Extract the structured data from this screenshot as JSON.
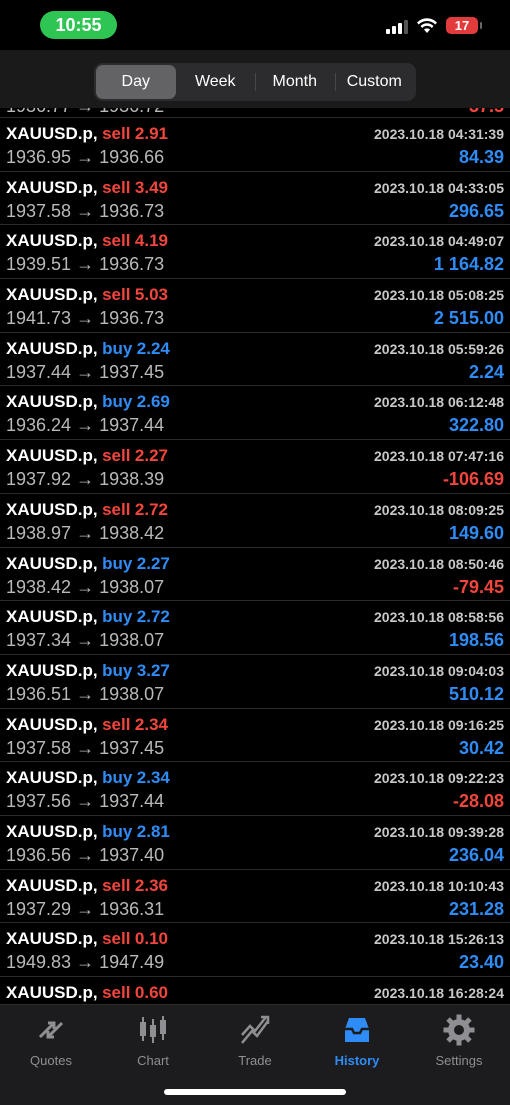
{
  "status_bar": {
    "time": "10:55",
    "battery": "17"
  },
  "segments": [
    {
      "label": "Day",
      "active": true
    },
    {
      "label": "Week",
      "active": false
    },
    {
      "label": "Month",
      "active": false
    },
    {
      "label": "Custom",
      "active": false
    }
  ],
  "arrow": "→",
  "trades": [
    {
      "symbol": "XAUUSD.p,",
      "side": "sell",
      "volume": "2.91",
      "datetime": "2023.10.18 04:31:39",
      "open": "1936.95",
      "close": "1936.66",
      "profit": "84.39"
    },
    {
      "symbol": "XAUUSD.p,",
      "side": "sell",
      "volume": "3.49",
      "datetime": "2023.10.18 04:33:05",
      "open": "1937.58",
      "close": "1936.73",
      "profit": "296.65"
    },
    {
      "symbol": "XAUUSD.p,",
      "side": "sell",
      "volume": "4.19",
      "datetime": "2023.10.18 04:49:07",
      "open": "1939.51",
      "close": "1936.73",
      "profit": "1 164.82"
    },
    {
      "symbol": "XAUUSD.p,",
      "side": "sell",
      "volume": "5.03",
      "datetime": "2023.10.18 05:08:25",
      "open": "1941.73",
      "close": "1936.73",
      "profit": "2 515.00"
    },
    {
      "symbol": "XAUUSD.p,",
      "side": "buy",
      "volume": "2.24",
      "datetime": "2023.10.18 05:59:26",
      "open": "1937.44",
      "close": "1937.45",
      "profit": "2.24"
    },
    {
      "symbol": "XAUUSD.p,",
      "side": "buy",
      "volume": "2.69",
      "datetime": "2023.10.18 06:12:48",
      "open": "1936.24",
      "close": "1937.44",
      "profit": "322.80"
    },
    {
      "symbol": "XAUUSD.p,",
      "side": "sell",
      "volume": "2.27",
      "datetime": "2023.10.18 07:47:16",
      "open": "1937.92",
      "close": "1938.39",
      "profit": "-106.69"
    },
    {
      "symbol": "XAUUSD.p,",
      "side": "sell",
      "volume": "2.72",
      "datetime": "2023.10.18 08:09:25",
      "open": "1938.97",
      "close": "1938.42",
      "profit": "149.60"
    },
    {
      "symbol": "XAUUSD.p,",
      "side": "buy",
      "volume": "2.27",
      "datetime": "2023.10.18 08:50:46",
      "open": "1938.42",
      "close": "1938.07",
      "profit": "-79.45"
    },
    {
      "symbol": "XAUUSD.p,",
      "side": "buy",
      "volume": "2.72",
      "datetime": "2023.10.18 08:58:56",
      "open": "1937.34",
      "close": "1938.07",
      "profit": "198.56"
    },
    {
      "symbol": "XAUUSD.p,",
      "side": "buy",
      "volume": "3.27",
      "datetime": "2023.10.18 09:04:03",
      "open": "1936.51",
      "close": "1938.07",
      "profit": "510.12"
    },
    {
      "symbol": "XAUUSD.p,",
      "side": "sell",
      "volume": "2.34",
      "datetime": "2023.10.18 09:16:25",
      "open": "1937.58",
      "close": "1937.45",
      "profit": "30.42"
    },
    {
      "symbol": "XAUUSD.p,",
      "side": "buy",
      "volume": "2.34",
      "datetime": "2023.10.18 09:22:23",
      "open": "1937.56",
      "close": "1937.44",
      "profit": "-28.08"
    },
    {
      "symbol": "XAUUSD.p,",
      "side": "buy",
      "volume": "2.81",
      "datetime": "2023.10.18 09:39:28",
      "open": "1936.56",
      "close": "1937.40",
      "profit": "236.04"
    },
    {
      "symbol": "XAUUSD.p,",
      "side": "sell",
      "volume": "2.36",
      "datetime": "2023.10.18 10:10:43",
      "open": "1937.29",
      "close": "1936.31",
      "profit": "231.28"
    },
    {
      "symbol": "XAUUSD.p,",
      "side": "sell",
      "volume": "0.10",
      "datetime": "2023.10.18 15:26:13",
      "open": "1949.83",
      "close": "1947.49",
      "profit": "23.40"
    },
    {
      "symbol": "XAUUSD.p,",
      "side": "sell",
      "volume": "0.60",
      "datetime": "2023.10.18 16:28:24",
      "open": "",
      "close": "",
      "profit": ""
    }
  ],
  "tabs": [
    {
      "label": "Quotes",
      "icon": "quotes-icon",
      "active": false
    },
    {
      "label": "Chart",
      "icon": "chart-icon",
      "active": false
    },
    {
      "label": "Trade",
      "icon": "trade-icon",
      "active": false
    },
    {
      "label": "History",
      "icon": "history-icon",
      "active": true
    },
    {
      "label": "Settings",
      "icon": "settings-icon",
      "active": false
    }
  ],
  "colors": {
    "sell": "#f2453d",
    "buy": "#2f8cf6",
    "active_tab": "#2f8cf6",
    "time_pill": "#2fc552"
  }
}
